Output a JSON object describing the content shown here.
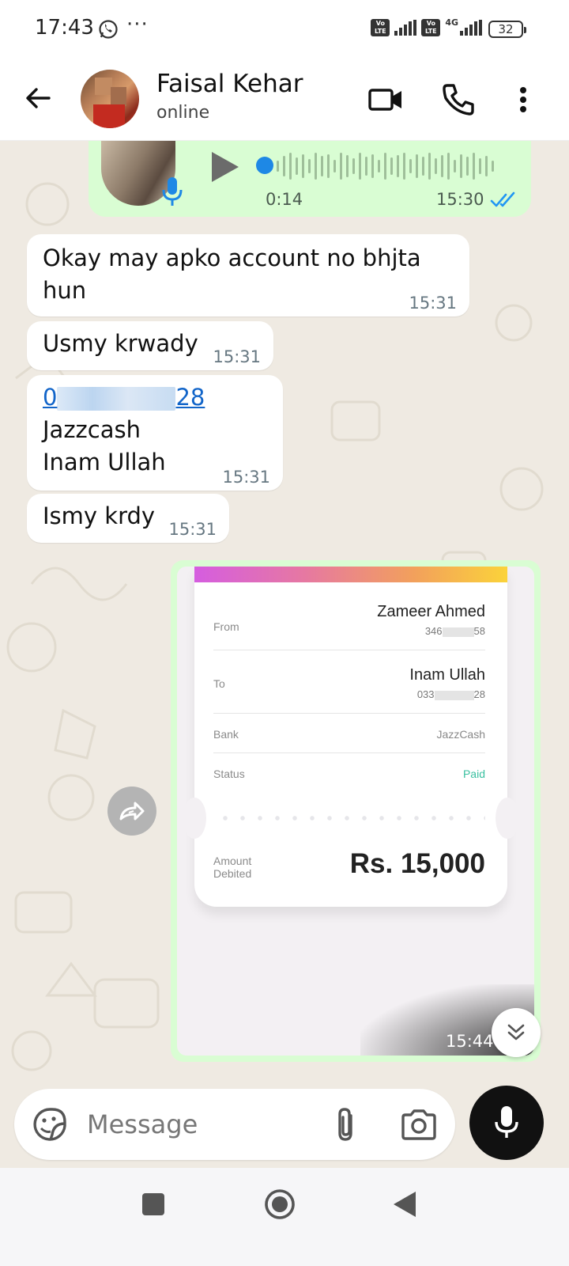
{
  "status_bar": {
    "time": "17:43",
    "whatsapp_icon": "whatsapp-icon",
    "more_dots": "···",
    "volte1": "Vo LTE",
    "volte2": "Vo LTE",
    "network": "4G",
    "battery": "32"
  },
  "header": {
    "contact_name": "Faisal Kehar",
    "contact_status": "online",
    "icons": [
      "back-arrow-icon",
      "video-call-icon",
      "phone-icon",
      "more-vert-icon"
    ]
  },
  "messages": {
    "voice": {
      "duration": "0:14",
      "time": "15:30",
      "status": "read"
    },
    "msg1": {
      "line1": "Okay may apko account no bhjta",
      "line2": "hun",
      "time": "15:31"
    },
    "msg2": {
      "text": "Usmy krwady",
      "time": "15:31"
    },
    "msg3": {
      "account_start": "0",
      "account_end": "28",
      "line2": "Jazzcash",
      "line3": "Inam Ullah",
      "time": "15:31"
    },
    "msg4": {
      "text": "Ismy krdy",
      "time": "15:31"
    },
    "image": {
      "time": "15:44",
      "receipt": {
        "from_label": "From",
        "from_name": "Zameer Ahmed",
        "from_number_start": "346",
        "from_number_end": "58",
        "to_label": "To",
        "to_name": "Inam Ullah",
        "to_number_start": "033",
        "to_number_end": "28",
        "bank_label": "Bank",
        "bank_value": "JazzCash",
        "status_label": "Status",
        "status_value": "Paid",
        "amount_label": "Amount Debited",
        "amount_value": "Rs. 15,000"
      }
    }
  },
  "composer": {
    "placeholder": "Message"
  },
  "colors": {
    "outgoing_bubble": "#d9fdd3",
    "incoming_bubble": "#ffffff",
    "chat_bg": "#efeae2",
    "link": "#1265c9",
    "read_ticks": "#34b7f1",
    "paid": "#3ac0a0"
  }
}
